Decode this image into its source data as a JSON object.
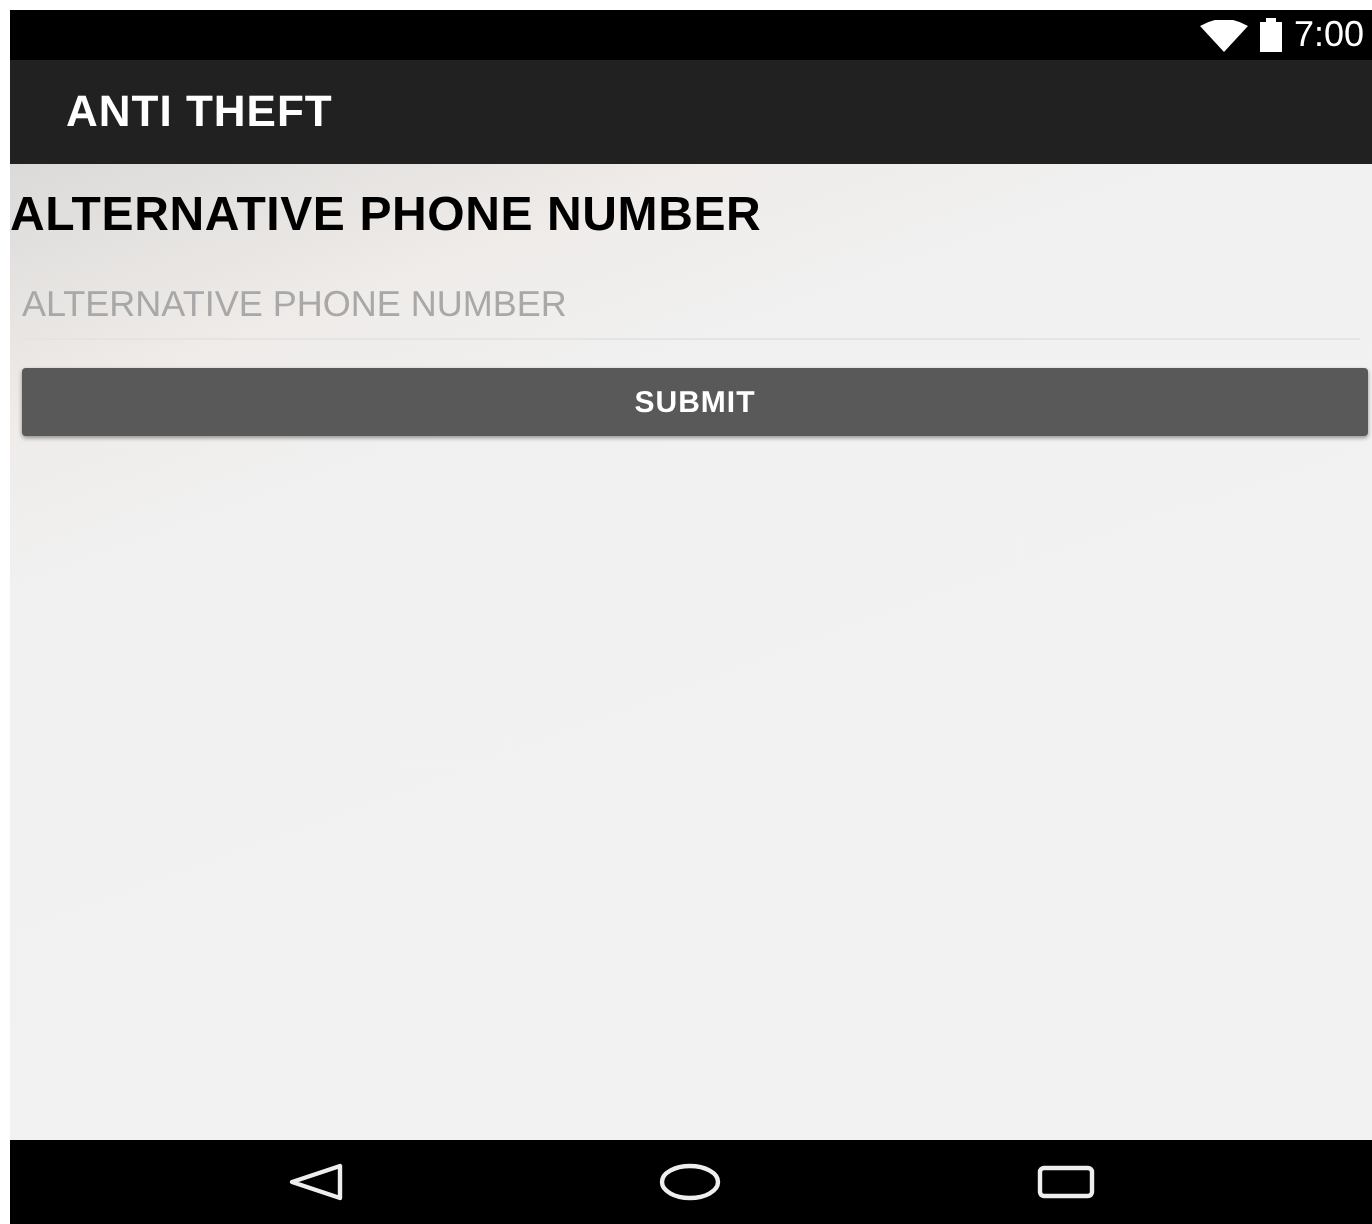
{
  "status_bar": {
    "time": "7:00"
  },
  "app_bar": {
    "title": "ANTI THEFT"
  },
  "form": {
    "heading": "ALTERNATIVE PHONE NUMBER",
    "phone_field": {
      "placeholder": "ALTERNATIVE PHONE NUMBER"
    },
    "submit_button": "SUBMIT"
  }
}
